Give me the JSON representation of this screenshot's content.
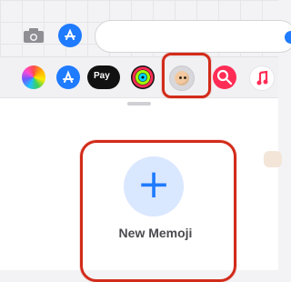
{
  "top_bar": {
    "camera_icon": "camera-icon",
    "appstore_icon": "app-store-icon",
    "send_icon": "send-icon"
  },
  "app_strip": {
    "items": [
      {
        "name": "photos"
      },
      {
        "name": "app-store"
      },
      {
        "name": "apple-pay",
        "label": "Pay"
      },
      {
        "name": "fitness"
      },
      {
        "name": "memoji"
      },
      {
        "name": "image-search"
      },
      {
        "name": "music"
      }
    ]
  },
  "memoji_panel": {
    "new_memoji_label": "New Memoji",
    "plus_glyph": "+"
  },
  "colors": {
    "accent": "#1f7bff",
    "highlight": "#d22b1a"
  }
}
